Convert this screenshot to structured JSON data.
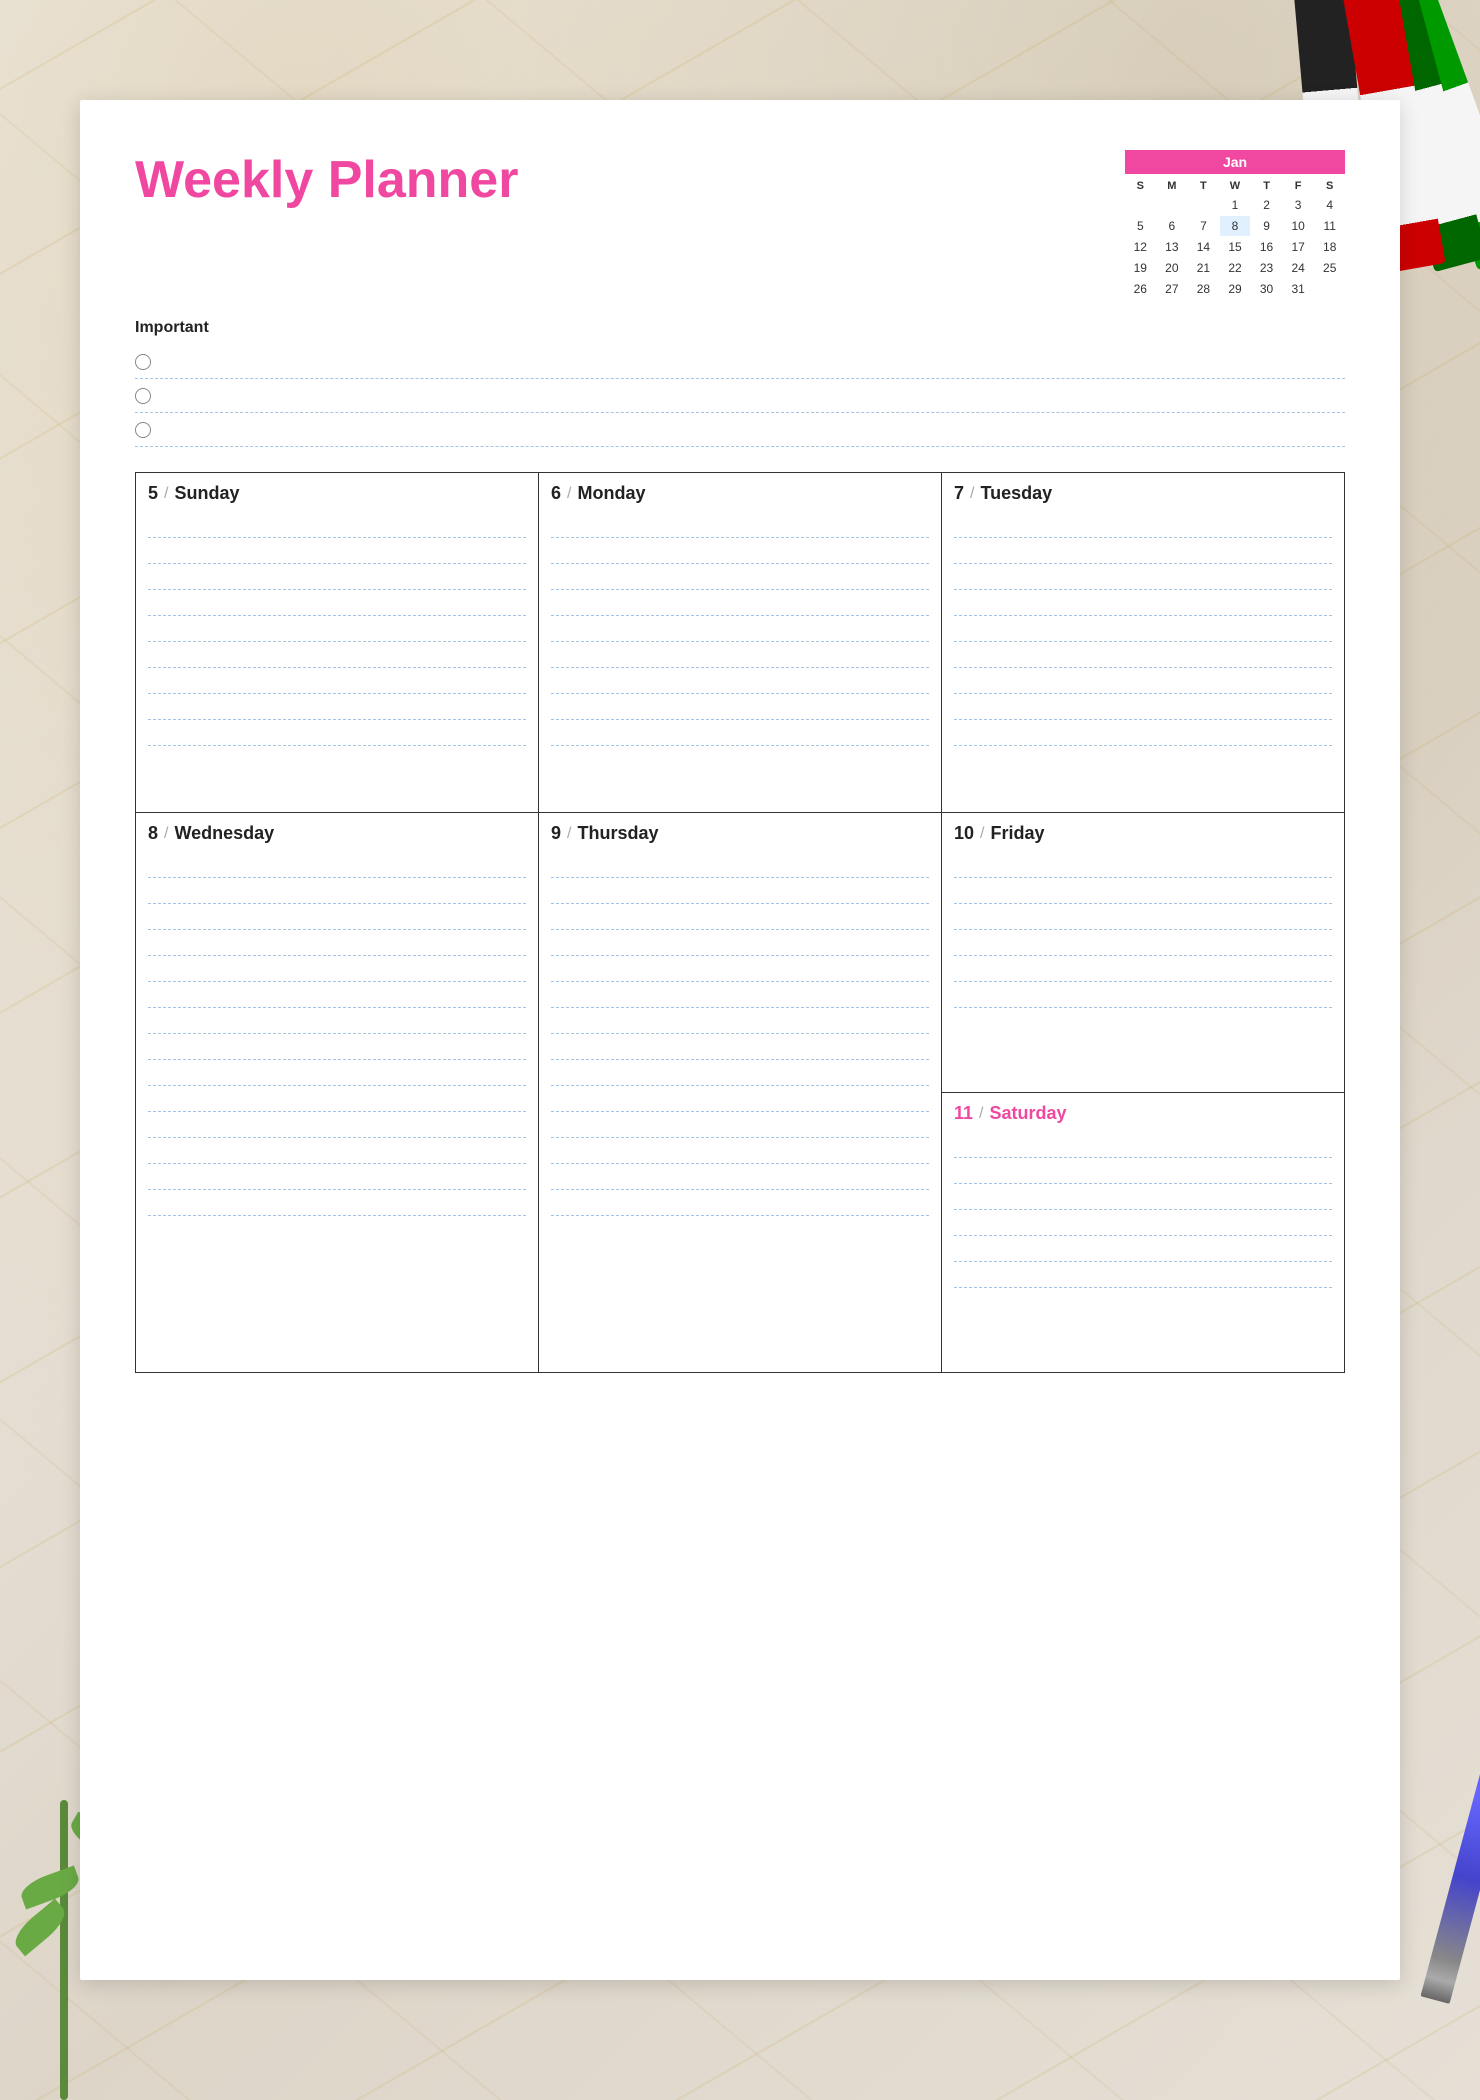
{
  "title": "Weekly Planner",
  "colors": {
    "pink": "#f048a0",
    "blue_dashed": "#a0c4e8",
    "dark": "#222222"
  },
  "important": {
    "label": "Important",
    "rows": [
      "",
      "",
      ""
    ]
  },
  "mini_calendar": {
    "month": "January",
    "month_short": "Jan",
    "day_headers": [
      "S",
      "M",
      "T",
      "W",
      "T",
      "F",
      "S"
    ],
    "weeks": [
      [
        "",
        "",
        "",
        "1",
        "2",
        "3",
        "4"
      ],
      [
        "5",
        "6",
        "7",
        "8",
        "9",
        "10",
        "11"
      ],
      [
        "12",
        "13",
        "14",
        "15",
        "16",
        "17",
        "18"
      ],
      [
        "19",
        "20",
        "21",
        "22",
        "23",
        "24",
        "25"
      ],
      [
        "26",
        "27",
        "28",
        "29",
        "30",
        "31",
        ""
      ]
    ]
  },
  "days_row1": [
    {
      "number": "5",
      "name": "Sunday"
    },
    {
      "number": "6",
      "name": "Monday"
    },
    {
      "number": "7",
      "name": "Tuesday"
    }
  ],
  "days_row2_left": [
    {
      "number": "8",
      "name": "Wednesday"
    },
    {
      "number": "9",
      "name": "Thursday"
    }
  ],
  "day_friday": {
    "number": "10",
    "name": "Friday"
  },
  "day_saturday": {
    "number": "11",
    "name": "Saturday",
    "highlight": true
  },
  "slash": "/"
}
